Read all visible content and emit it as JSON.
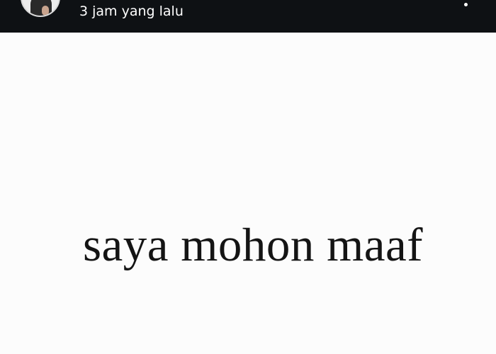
{
  "header": {
    "timestamp": "3 jam yang lalu",
    "avatar_icon": "user-avatar-icon",
    "more_icon": "more-options-icon"
  },
  "story": {
    "text": "saya mohon maaf"
  },
  "colors": {
    "header_background": "#0e1114",
    "header_text": "#ffffff",
    "story_background": "#fcfcfc",
    "story_text": "#141414"
  }
}
